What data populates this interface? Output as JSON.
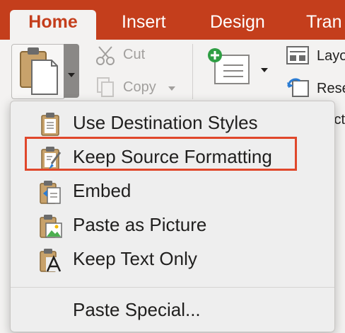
{
  "tabs": {
    "home": "Home",
    "insert": "Insert",
    "design": "Design",
    "transitions_partial": "Tran"
  },
  "clipboard": {
    "cut": "Cut",
    "copy": "Copy"
  },
  "slides": {
    "layout_partial": "Layo",
    "reset_partial": "Rese",
    "section_partial": "Sect"
  },
  "paste_menu": {
    "items": [
      {
        "label": "Use Destination Styles",
        "icon": "clipboard-icon"
      },
      {
        "label": "Keep Source Formatting",
        "icon": "clipboard-brush-icon",
        "highlighted": true
      },
      {
        "label": "Embed",
        "icon": "clipboard-embed-icon"
      },
      {
        "label": "Paste as Picture",
        "icon": "clipboard-picture-icon"
      },
      {
        "label": "Keep Text Only",
        "icon": "clipboard-text-icon"
      }
    ],
    "special": "Paste Special..."
  },
  "colors": {
    "accent": "#c43e1c",
    "highlight_border": "#e0472b"
  }
}
